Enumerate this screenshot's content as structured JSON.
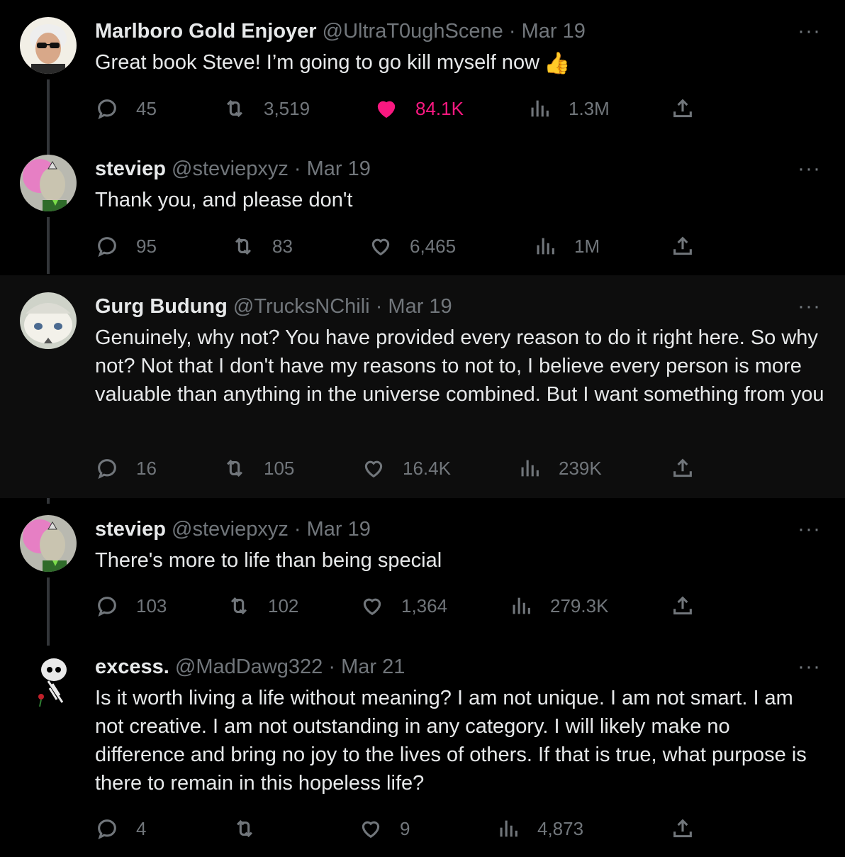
{
  "tweets": [
    {
      "name": "Marlboro Gold Enjoyer",
      "handle": "@UltraT0ughScene",
      "dot": "·",
      "date": "Mar 19",
      "text": "Great book Steve! I’m going to go kill myself now",
      "emoji": "👍",
      "replies": "45",
      "retweets": "3,519",
      "likes": "84.1K",
      "views": "1.3M",
      "liked": true
    },
    {
      "name": "steviep",
      "handle": "@steviepxyz",
      "dot": "·",
      "date": "Mar 19",
      "text": "Thank you, and please don't",
      "replies": "95",
      "retweets": "83",
      "likes": "6,465",
      "views": "1M"
    },
    {
      "name": "Gurg Budung",
      "handle": "@TrucksNChili",
      "dot": "·",
      "date": "Mar 19",
      "text": "Genuinely, why not? You have provided every reason to do it right here. So why not? Not that I don't have my reasons to not to, I believe every person is more valuable than anything in the universe combined. But I want something from you",
      "replies": "16",
      "retweets": "105",
      "likes": "16.4K",
      "views": "239K"
    },
    {
      "name": "steviep",
      "handle": "@steviepxyz",
      "dot": "·",
      "date": "Mar 19",
      "text": "There's more to life than being special",
      "replies": "103",
      "retweets": "102",
      "likes": "1,364",
      "views": "279.3K"
    },
    {
      "name": "excess.",
      "handle": "@MadDawg322",
      "dot": "·",
      "date": "Mar 21",
      "text": "Is it worth living a life without meaning? I am not unique. I am not smart. I am not creative. I am not outstanding in any category. I will likely make no difference and bring no  joy to the lives of others. If that is true, what purpose is there to remain in this hopeless life?",
      "replies": "4",
      "retweets": "",
      "likes": "9",
      "views": "4,873"
    }
  ],
  "more_label": "···",
  "icons": {
    "reply": "reply-icon",
    "retweet": "retweet-icon",
    "like": "heart-icon",
    "views": "views-chart-icon",
    "share": "share-icon",
    "more": "more-options-icon"
  },
  "colors": {
    "background": "#000000",
    "highlight": "#0d0d0d",
    "text": "#e7e9ea",
    "muted": "#71767b",
    "like": "#f91880"
  }
}
